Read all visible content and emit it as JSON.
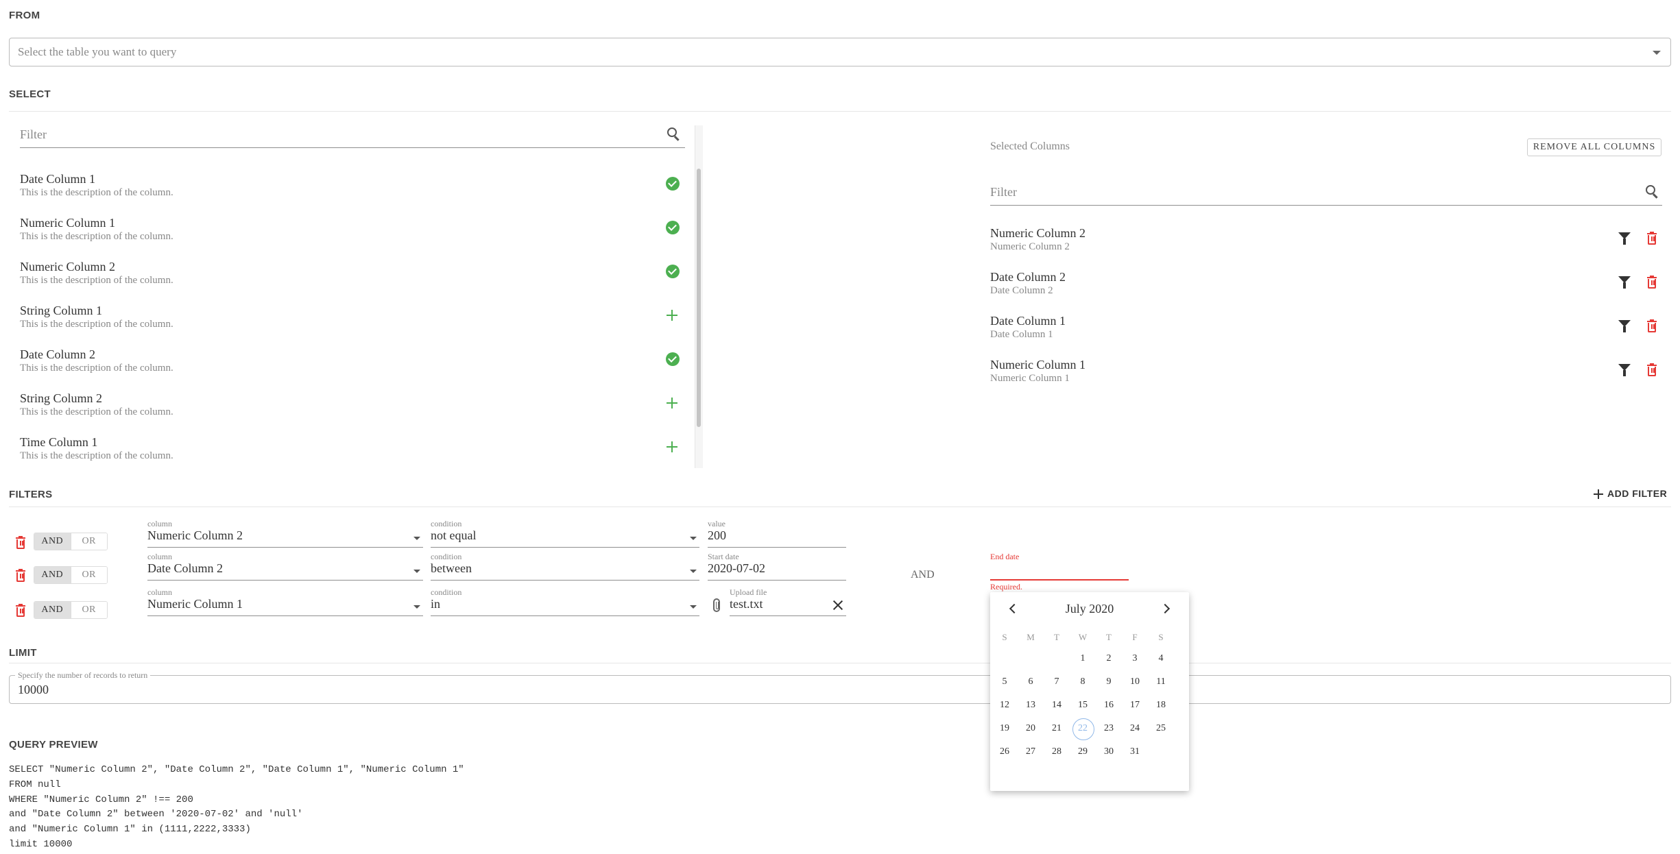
{
  "from": {
    "title": "FROM",
    "placeholder": "Select the table you want to query"
  },
  "select": {
    "title": "SELECT",
    "filter_placeholder": "Filter",
    "available_columns": [
      {
        "name": "Date Column 1",
        "description": "This is the description of the column.",
        "selected": true
      },
      {
        "name": "Numeric Column 1",
        "description": "This is the description of the column.",
        "selected": true
      },
      {
        "name": "Numeric Column 2",
        "description": "This is the description of the column.",
        "selected": true
      },
      {
        "name": "String Column 1",
        "description": "This is the description of the column.",
        "selected": false
      },
      {
        "name": "Date Column 2",
        "description": "This is the description of the column.",
        "selected": true
      },
      {
        "name": "String Column 2",
        "description": "This is the description of the column.",
        "selected": false
      },
      {
        "name": "Time Column 1",
        "description": "This is the description of the column.",
        "selected": false
      }
    ],
    "selected_label": "Selected Columns",
    "remove_all_label": "REMOVE ALL COLUMNS",
    "selected_filter_placeholder": "Filter",
    "selected_columns": [
      {
        "name": "Numeric Column 2",
        "subtitle": "Numeric Column 2"
      },
      {
        "name": "Date Column 2",
        "subtitle": "Date Column 2"
      },
      {
        "name": "Date Column 1",
        "subtitle": "Date Column 1"
      },
      {
        "name": "Numeric Column 1",
        "subtitle": "Numeric Column 1"
      }
    ]
  },
  "filters": {
    "title": "FILTERS",
    "add_label": "ADD FILTER",
    "and_label": "AND",
    "or_label": "OR",
    "between_and": "AND",
    "rows": [
      {
        "column_label": "column",
        "column": "Numeric Column 2",
        "condition_label": "condition",
        "condition": "not equal",
        "value_label": "value",
        "value": "200"
      },
      {
        "column_label": "column",
        "column": "Date Column 2",
        "condition_label": "condition",
        "condition": "between",
        "value_label": "Start date",
        "value": "2020-07-02",
        "end_label": "End date",
        "end_error": "Required."
      },
      {
        "column_label": "column",
        "column": "Numeric Column 1",
        "condition_label": "condition",
        "condition": "in",
        "value_label": "Upload file",
        "value": "test.txt"
      }
    ]
  },
  "limit": {
    "title": "LIMIT",
    "label": "Specify the number of records to return",
    "value": "10000"
  },
  "preview": {
    "title": "QUERY PREVIEW",
    "lines": [
      "SELECT \"Numeric Column 2\", \"Date Column 2\", \"Date Column 1\", \"Numeric Column 1\"",
      "FROM null",
      "WHERE \"Numeric Column 2\" !== 200",
      "and \"Date Column 2\" between '2020-07-02' and 'null'",
      "and \"Numeric Column 1\" in (1111,2222,3333)",
      "limit 10000"
    ]
  },
  "calendar": {
    "month_label": "July 2020",
    "weekdays": [
      "S",
      "M",
      "T",
      "W",
      "T",
      "F",
      "S"
    ],
    "first_weekday": 3,
    "days_in_month": 31,
    "today": 22
  },
  "colors": {
    "accent_green": "#4caf50",
    "danger_red": "#e53935",
    "today_blue": "#90b8e8"
  }
}
